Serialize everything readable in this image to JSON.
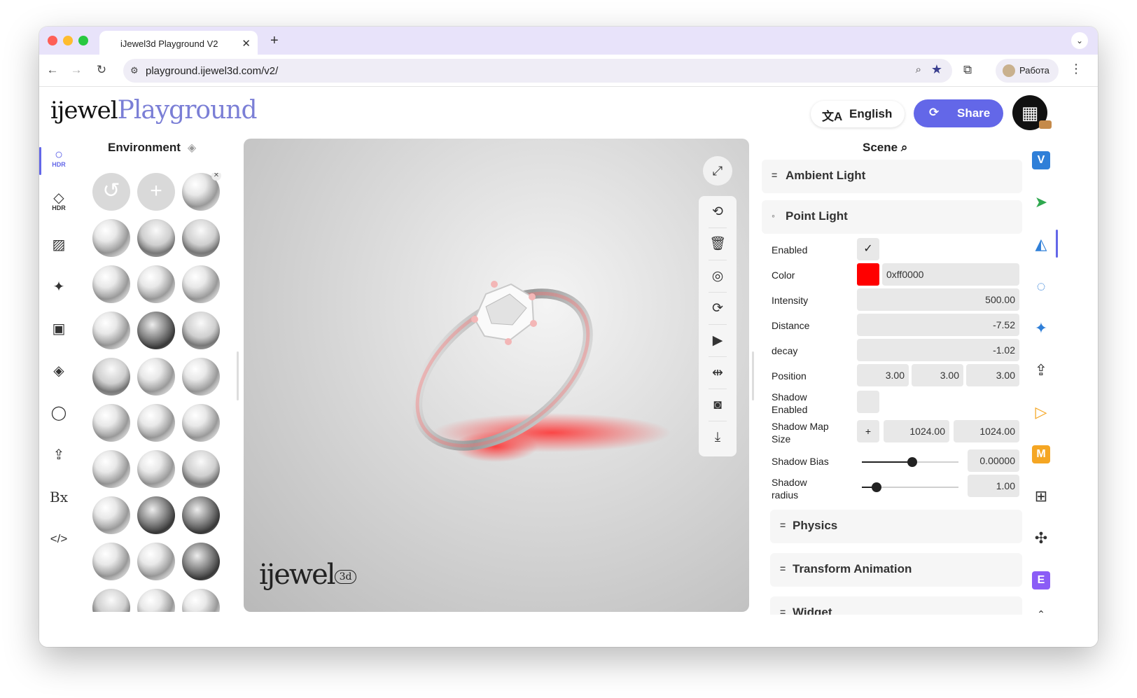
{
  "browser": {
    "tab_title": "iJewel3d Playground V2",
    "url": "playground.ijewel3d.com/v2/",
    "profile_label": "Работа"
  },
  "header": {
    "logo_part1": "ijewel",
    "logo_part2": "Playground",
    "language_label": "English",
    "share_label": "Share"
  },
  "left_rail": {
    "hdr_label_1": "HDR",
    "hdr_label_2": "HDR"
  },
  "environment": {
    "title": "Environment"
  },
  "viewport": {
    "logo_text": "ijewel",
    "logo_badge": "3d"
  },
  "scene": {
    "title": "Scene",
    "sections": {
      "ambient_light": "Ambient Light",
      "point_light": "Point Light",
      "physics": "Physics",
      "transform_animation": "Transform Animation",
      "widget": "Widget"
    },
    "point_light": {
      "enabled_label": "Enabled",
      "color_label": "Color",
      "color_value": "0xff0000",
      "color_hex": "#ff0000",
      "intensity_label": "Intensity",
      "intensity_value": "500.00",
      "distance_label": "Distance",
      "distance_value": "-7.52",
      "decay_label": "decay",
      "decay_value": "-1.02",
      "position_label": "Position",
      "position_x": "3.00",
      "position_y": "3.00",
      "position_z": "3.00",
      "shadow_enabled_label_1": "Shadow",
      "shadow_enabled_label_2": "Enabled",
      "shadow_map_label_1": "Shadow Map",
      "shadow_map_label_2": "Size",
      "shadow_map_w": "1024.00",
      "shadow_map_h": "1024.00",
      "shadow_bias_label": "Shadow Bias",
      "shadow_bias_value": "0.00000",
      "shadow_bias_level": 0.52,
      "shadow_radius_label_1": "Shadow",
      "shadow_radius_label_2": "radius",
      "shadow_radius_value": "1.00",
      "shadow_radius_level": 0.15
    }
  },
  "right_rail": {
    "v_label": "V",
    "m_label": "M",
    "e_label": "E"
  },
  "colors": {
    "accent": "#6367e8",
    "v_badge": "#2f7fd8",
    "m_badge": "#f5a623",
    "e_badge": "#8b5cf6",
    "play_icon": "#f5a623",
    "cursor_icon": "#2fa84f"
  }
}
